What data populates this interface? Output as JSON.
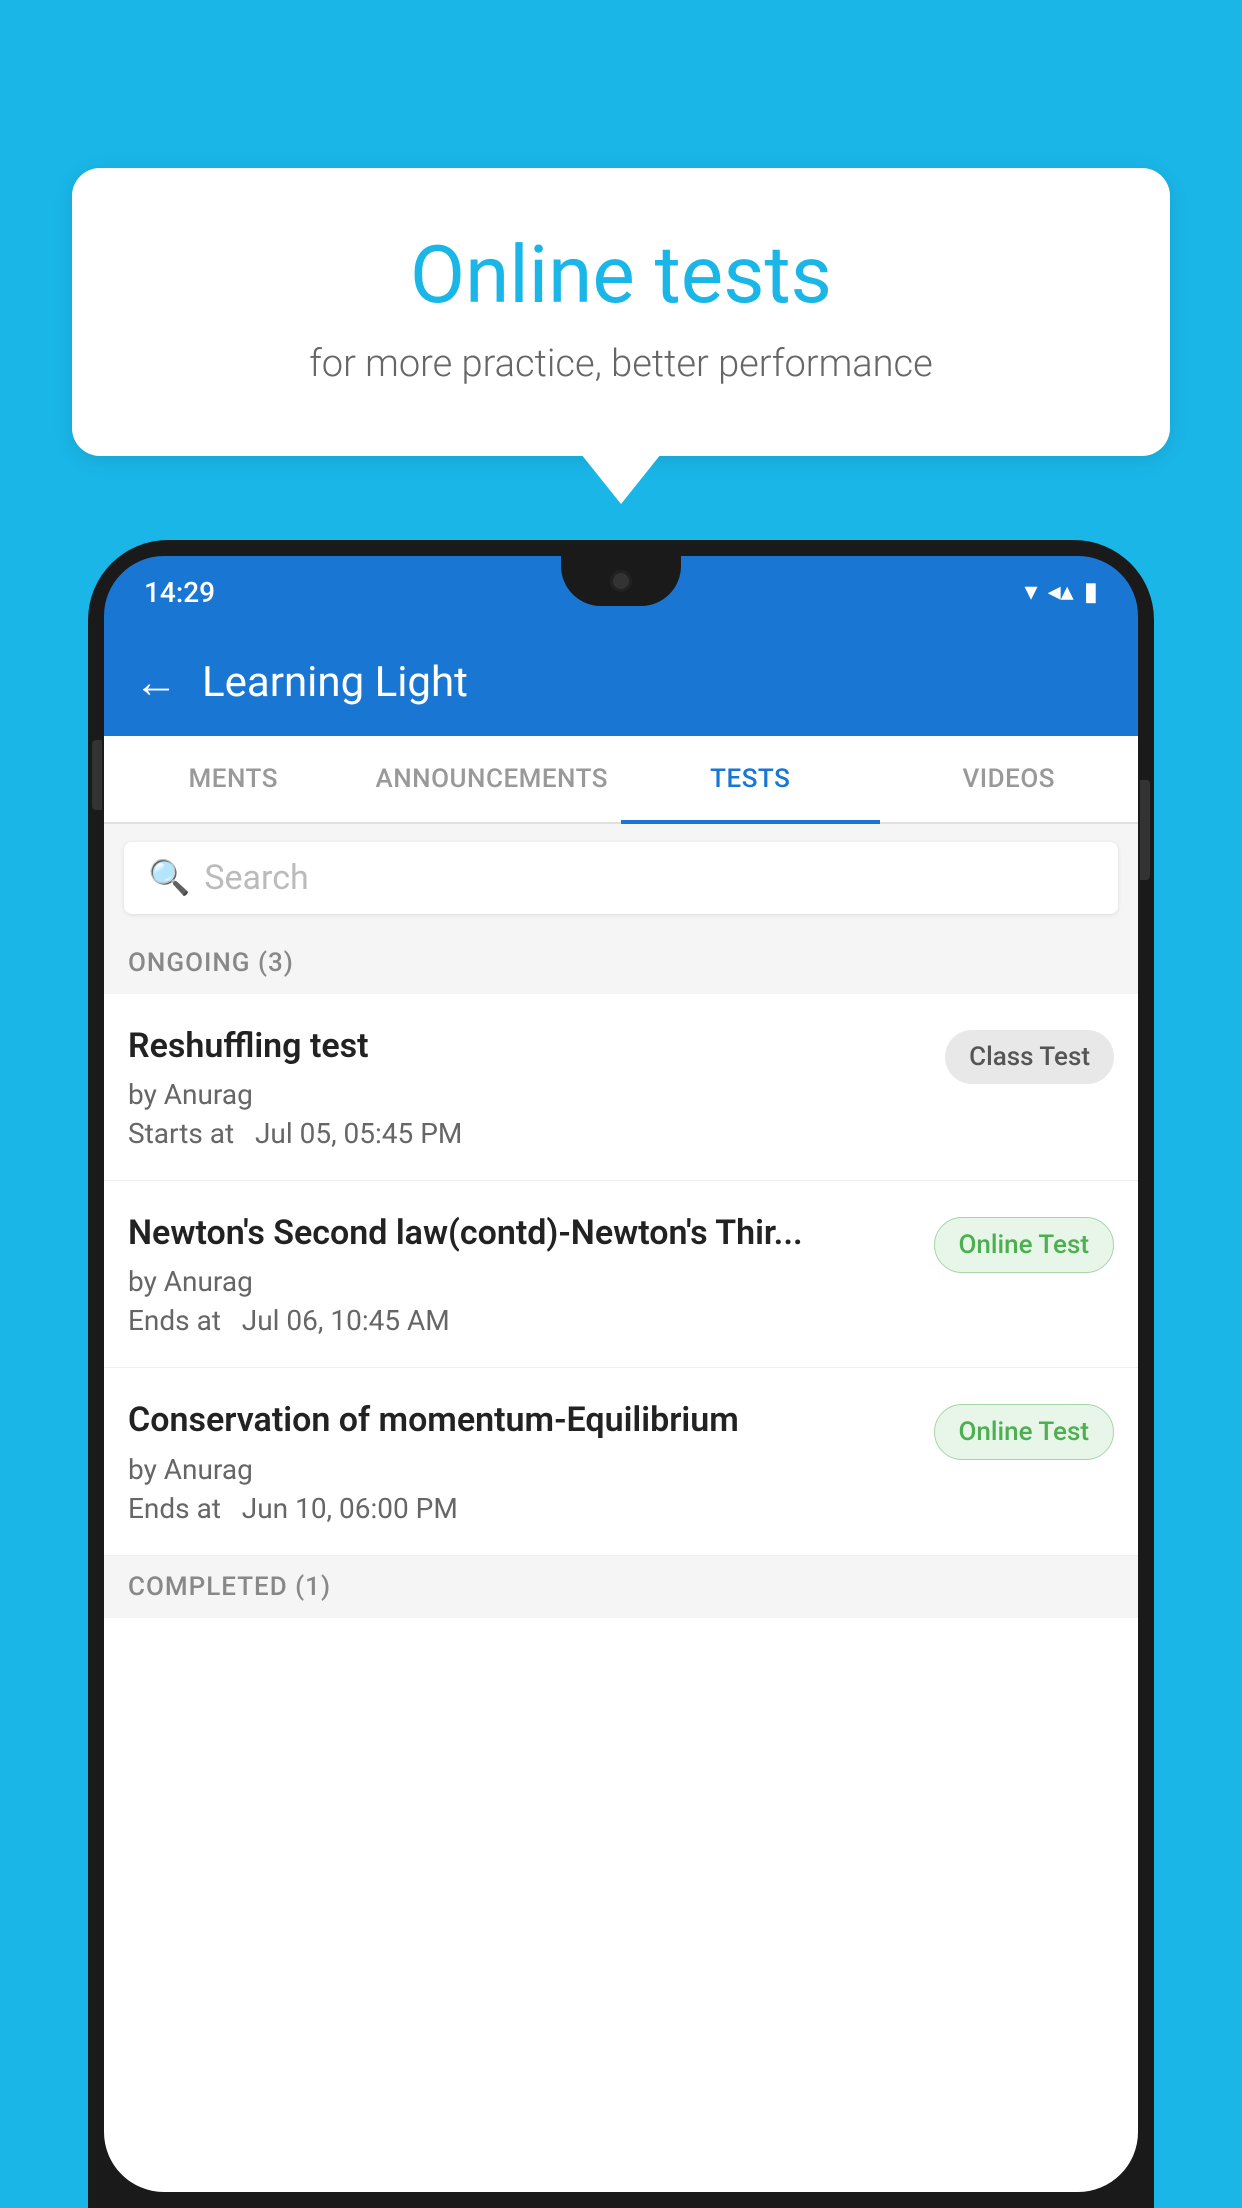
{
  "background": {
    "color": "#1ab6e8"
  },
  "speech_bubble": {
    "title": "Online tests",
    "subtitle": "for more practice, better performance"
  },
  "phone": {
    "status_bar": {
      "time": "14:29",
      "wifi_icon": "▾",
      "signal_icon": "▲",
      "battery_icon": "▮"
    },
    "header": {
      "back_label": "←",
      "title": "Learning Light"
    },
    "tabs": [
      {
        "label": "MENTS",
        "active": false
      },
      {
        "label": "ANNOUNCEMENTS",
        "active": false
      },
      {
        "label": "TESTS",
        "active": true
      },
      {
        "label": "VIDEOS",
        "active": false
      }
    ],
    "search": {
      "placeholder": "Search"
    },
    "sections": [
      {
        "label": "ONGOING (3)",
        "tests": [
          {
            "name": "Reshuffling test",
            "by": "by Anurag",
            "time": "Starts at  Jul 05, 05:45 PM",
            "badge": "Class Test",
            "badge_type": "class"
          },
          {
            "name": "Newton's Second law(contd)-Newton's Thir...",
            "by": "by Anurag",
            "time": "Ends at  Jul 06, 10:45 AM",
            "badge": "Online Test",
            "badge_type": "online"
          },
          {
            "name": "Conservation of momentum-Equilibrium",
            "by": "by Anurag",
            "time": "Ends at  Jun 10, 06:00 PM",
            "badge": "Online Test",
            "badge_type": "online"
          }
        ]
      },
      {
        "label": "COMPLETED (1)",
        "tests": []
      }
    ]
  }
}
